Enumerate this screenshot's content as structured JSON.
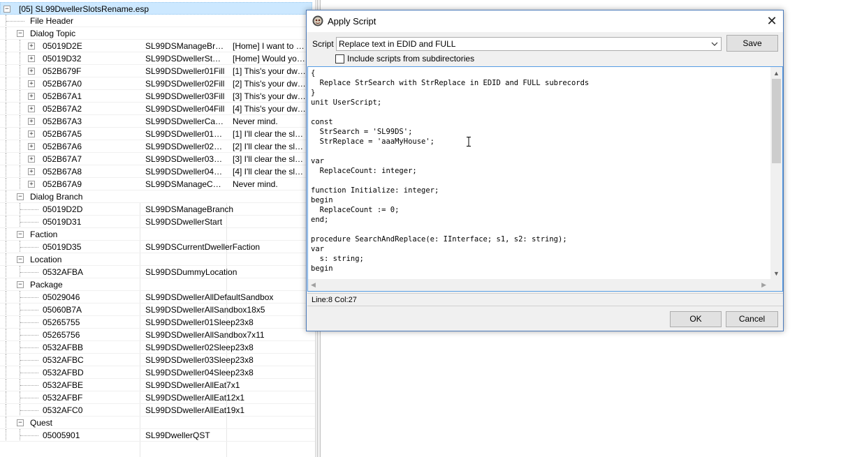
{
  "tree": {
    "root_label": "[05] SL99DwellerSlotsRename.esp",
    "rows": [
      {
        "id": "",
        "edid": "",
        "name": "",
        "label": "File Header",
        "level": 1
      },
      {
        "label": "Dialog Topic",
        "level": 1,
        "group": true
      },
      {
        "id": "05019D2E",
        "edid": "SL99DSManageBra...",
        "name": "[Home] I want to m...",
        "level": 2,
        "expandable": true
      },
      {
        "id": "05019D32",
        "edid": "SL99DSDwellerStart...",
        "name": "[Home] Would you ...",
        "level": 2,
        "expandable": true
      },
      {
        "id": "052B679F",
        "edid": "SL99DSDweller01Fill",
        "name": "[1] This's your dwell...",
        "level": 2,
        "expandable": true
      },
      {
        "id": "052B67A0",
        "edid": "SL99DSDweller02Fill",
        "name": "[2] This's your dwell...",
        "level": 2,
        "expandable": true
      },
      {
        "id": "052B67A1",
        "edid": "SL99DSDweller03Fill",
        "name": "[3] This's your dwell...",
        "level": 2,
        "expandable": true
      },
      {
        "id": "052B67A2",
        "edid": "SL99DSDweller04Fill",
        "name": "[4] This's your dwell...",
        "level": 2,
        "expandable": true
      },
      {
        "id": "052B67A3",
        "edid": "SL99DSDwellerCancel",
        "name": "Never mind.",
        "level": 2,
        "expandable": true
      },
      {
        "id": "052B67A5",
        "edid": "SL99DSDweller01Cl...",
        "name": "[1] I'll clear the slot ...",
        "level": 2,
        "expandable": true
      },
      {
        "id": "052B67A6",
        "edid": "SL99DSDweller02Cl...",
        "name": "[2] I'll clear the slot ...",
        "level": 2,
        "expandable": true
      },
      {
        "id": "052B67A7",
        "edid": "SL99DSDweller03Cl...",
        "name": "[3] I'll clear the slot ...",
        "level": 2,
        "expandable": true
      },
      {
        "id": "052B67A8",
        "edid": "SL99DSDweller04Cl...",
        "name": "[4] I'll clear the slot ...",
        "level": 2,
        "expandable": true
      },
      {
        "id": "052B67A9",
        "edid": "SL99DSManageCan...",
        "name": "Never mind.",
        "level": 2,
        "expandable": true
      },
      {
        "label": "Dialog Branch",
        "level": 1,
        "group": true
      },
      {
        "id": "05019D2D",
        "edid": "SL99DSManageBranch",
        "name": "",
        "level": 2
      },
      {
        "id": "05019D31",
        "edid": "SL99DSDwellerStart",
        "name": "",
        "level": 2
      },
      {
        "label": "Faction",
        "level": 1,
        "group": true
      },
      {
        "id": "05019D35",
        "edid": "SL99DSCurrentDwellerFaction",
        "name": "",
        "level": 2
      },
      {
        "label": "Location",
        "level": 1,
        "group": true
      },
      {
        "id": "0532AFBA",
        "edid": "SL99DSDummyLocation",
        "name": "",
        "level": 2
      },
      {
        "label": "Package",
        "level": 1,
        "group": true
      },
      {
        "id": "05029046",
        "edid": "SL99DSDwellerAllDefaultSandbox",
        "name": "",
        "level": 2
      },
      {
        "id": "05060B7A",
        "edid": "SL99DSDwellerAllSandbox18x5",
        "name": "",
        "level": 2
      },
      {
        "id": "05265755",
        "edid": "SL99DSDweller01Sleep23x8",
        "name": "",
        "level": 2
      },
      {
        "id": "05265756",
        "edid": "SL99DSDwellerAllSandbox7x11",
        "name": "",
        "level": 2
      },
      {
        "id": "0532AFBB",
        "edid": "SL99DSDweller02Sleep23x8",
        "name": "",
        "level": 2
      },
      {
        "id": "0532AFBC",
        "edid": "SL99DSDweller03Sleep23x8",
        "name": "",
        "level": 2
      },
      {
        "id": "0532AFBD",
        "edid": "SL99DSDweller04Sleep23x8",
        "name": "",
        "level": 2
      },
      {
        "id": "0532AFBE",
        "edid": "SL99DSDwellerAllEat7x1",
        "name": "",
        "level": 2
      },
      {
        "id": "0532AFBF",
        "edid": "SL99DSDwellerAllEat12x1",
        "name": "",
        "level": 2
      },
      {
        "id": "0532AFC0",
        "edid": "SL99DSDwellerAllEat19x1",
        "name": "",
        "level": 2
      },
      {
        "label": "Quest",
        "level": 1,
        "group": true
      },
      {
        "id": "05005901",
        "edid": "SL99DwellerQST",
        "name": "",
        "level": 2
      }
    ]
  },
  "dialog": {
    "title": "Apply Script",
    "close_glyph": "✕",
    "script_label": "Script",
    "script_selected": "Replace text in EDID and FULL",
    "save_label": "Save",
    "include_subdirs_label": "Include scripts from subdirectories",
    "include_subdirs_checked": false,
    "code": "{\n  Replace StrSearch with StrReplace in EDID and FULL subrecords\n}\nunit UserScript;\n\nconst\n  StrSearch = 'SL99DS';\n  StrReplace = 'aaaMyHouse';\n\nvar\n  ReplaceCount: integer;\n\nfunction Initialize: integer;\nbegin\n  ReplaceCount := 0;\nend;\n\nprocedure SearchAndReplace(e: IInterface; s1, s2: string);\nvar\n  s: string;\nbegin",
    "status": "Line:8 Col:27",
    "ok_label": "OK",
    "cancel_label": "Cancel"
  },
  "colors": {
    "selection": "#cce8ff",
    "dialog_border": "#4a79b9",
    "editor_focus": "#569de5",
    "button_face": "#e1e1e1"
  }
}
